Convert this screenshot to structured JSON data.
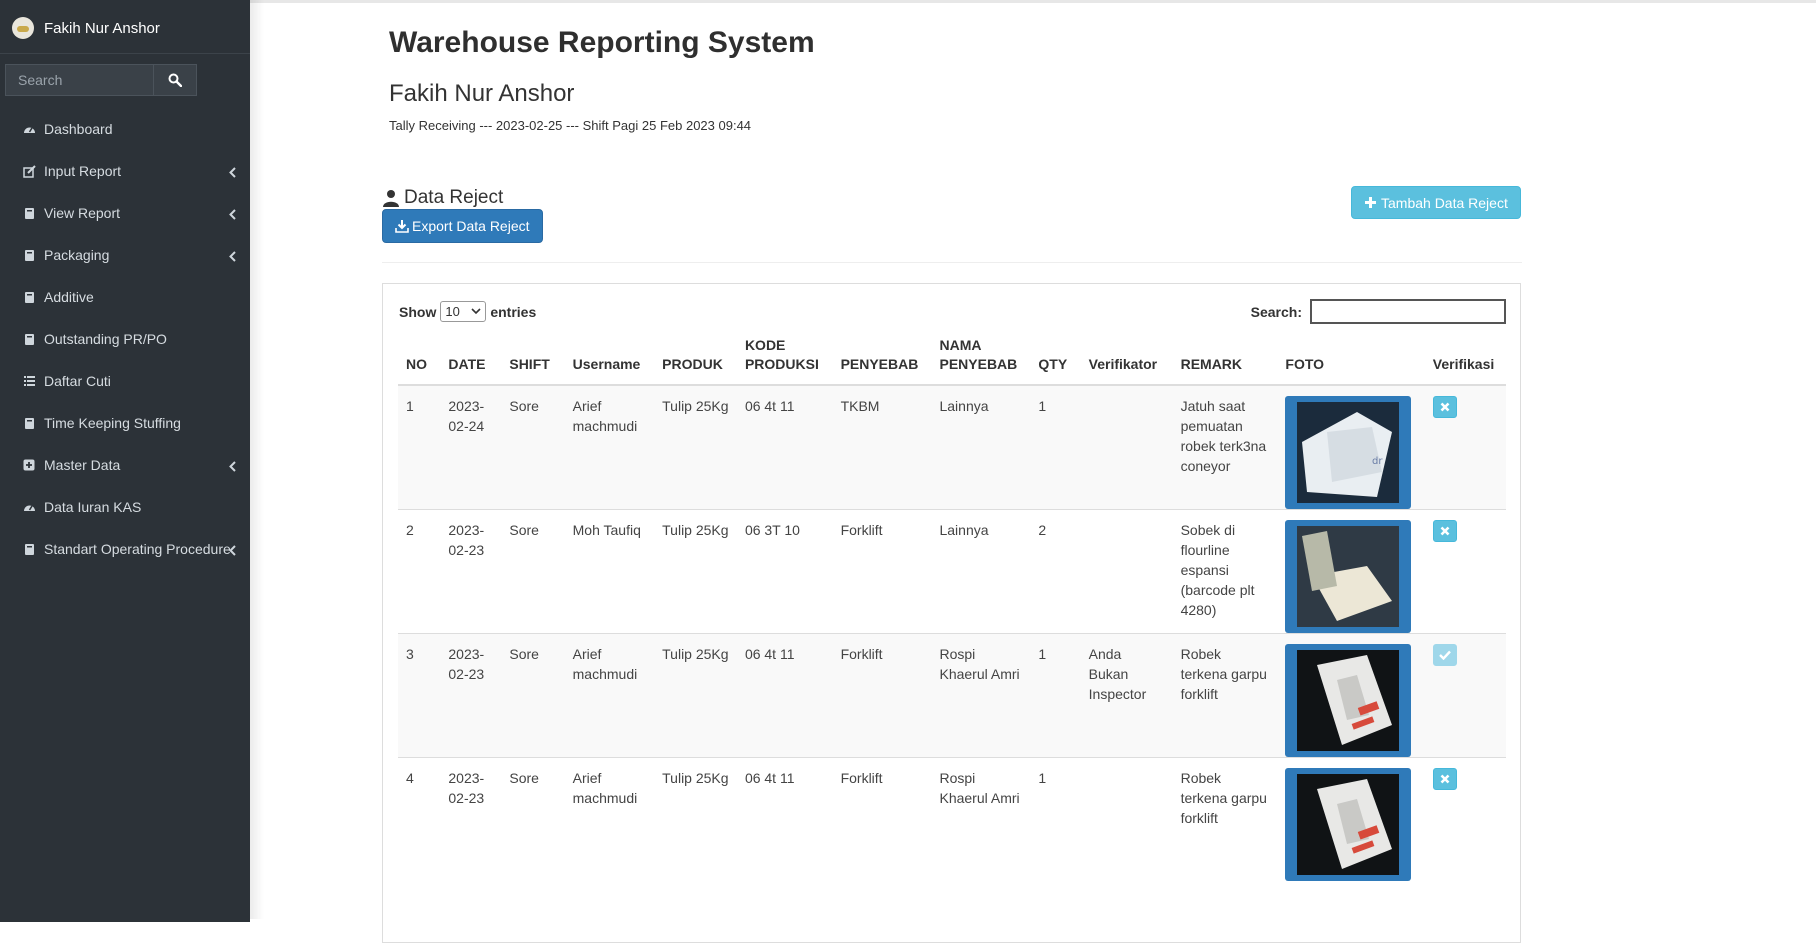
{
  "sidebar": {
    "username": "Fakih Nur Anshor",
    "search_placeholder": "Search",
    "items": [
      {
        "label": "Dashboard",
        "icon": "dashboard-icon",
        "chevron": false
      },
      {
        "label": "Input Report",
        "icon": "edit-icon",
        "chevron": true
      },
      {
        "label": "View Report",
        "icon": "book-icon",
        "chevron": true
      },
      {
        "label": "Packaging",
        "icon": "book-icon",
        "chevron": true
      },
      {
        "label": "Additive",
        "icon": "book-icon",
        "chevron": false
      },
      {
        "label": "Outstanding PR/PO",
        "icon": "book-icon",
        "chevron": false
      },
      {
        "label": "Daftar Cuti",
        "icon": "list-icon",
        "chevron": false
      },
      {
        "label": "Time Keeping Stuffing",
        "icon": "book-icon",
        "chevron": false
      },
      {
        "label": "Master Data",
        "icon": "plus-square-icon",
        "chevron": true
      },
      {
        "label": "Data Iuran KAS",
        "icon": "dashboard-icon",
        "chevron": false
      },
      {
        "label": "Standart Operating Procedure",
        "icon": "book-icon",
        "chevron": true
      }
    ]
  },
  "header": {
    "title": "Warehouse Reporting System",
    "user": "Fakih Nur Anshor",
    "shift_info": "Tally Receiving --- 2023-02-25 --- Shift Pagi 25 Feb 2023 09:44"
  },
  "section": {
    "title": "Data Reject",
    "export_label": "Export Data Reject",
    "add_label": "Tambah Data Reject"
  },
  "datatable": {
    "show_label": "Show",
    "entries_value": "10",
    "entries_label": "entries",
    "search_label": "Search:",
    "columns": [
      "NO",
      "DATE",
      "SHIFT",
      "Username",
      "PRODUK",
      "KODE PRODUKSI",
      "PENYEBAB",
      "NAMA PENYEBAB",
      "QTY",
      "Verifikator",
      "REMARK",
      "FOTO",
      "Verifikasi"
    ],
    "rows": [
      {
        "no": "1",
        "date": "2023-02-24",
        "shift": "Sore",
        "username": "Arief machmudi",
        "produk": "Tulip 25Kg",
        "kode": "06 4t 11",
        "penyebab": "TKBM",
        "nama_penyebab": "Lainnya",
        "qty": "1",
        "verifikator": "",
        "remark": "Jatuh saat pemuatan robek terk3na coneyor",
        "verified": false
      },
      {
        "no": "2",
        "date": "2023-02-23",
        "shift": "Sore",
        "username": "Moh Taufiq",
        "produk": "Tulip 25Kg",
        "kode": "06 3T 10",
        "penyebab": "Forklift",
        "nama_penyebab": "Lainnya",
        "qty": "2",
        "verifikator": "",
        "remark": "Sobek di flourline espansi (barcode plt 4280)",
        "verified": false
      },
      {
        "no": "3",
        "date": "2023-02-23",
        "shift": "Sore",
        "username": "Arief machmudi",
        "produk": "Tulip 25Kg",
        "kode": "06 4t 11",
        "penyebab": "Forklift",
        "nama_penyebab": "Rospi Khaerul Amri",
        "qty": "1",
        "verifikator": "Anda Bukan Inspector",
        "remark": "Robek terkena garpu forklift",
        "verified": true
      },
      {
        "no": "4",
        "date": "2023-02-23",
        "shift": "Sore",
        "username": "Arief machmudi",
        "produk": "Tulip 25Kg",
        "kode": "06 4t 11",
        "penyebab": "Forklift",
        "nama_penyebab": "Rospi Khaerul Amri",
        "qty": "1",
        "verifikator": "",
        "remark": "Robek terkena garpu forklift",
        "verified": false
      }
    ]
  }
}
